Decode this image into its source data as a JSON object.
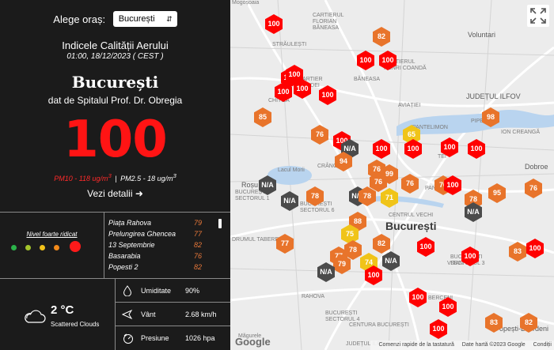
{
  "header": {
    "city_select_label": "Alege oraș:",
    "city_selected": "București",
    "title": "Indicele Calității Aerului",
    "datetime": "01:00, 18/12/2023 ( CEST )"
  },
  "current": {
    "city": "București",
    "source": "dat de Spitalul Prof. Dr. Obregia",
    "aqi": "100",
    "aqi_color": "#ff1414",
    "pm10": "PM10 - 118 ug/m",
    "pm10_sup": "3",
    "pm_separator": "|",
    "pm25": "PM2.5 - 18 ug/m",
    "pm25_sup": "3",
    "details_link": "Vezi detalii",
    "details_icon": "arrow-right-icon"
  },
  "level": {
    "label": "Nivel foarte ridicat",
    "scale_colors": [
      "#2bb34a",
      "#a3c42b",
      "#f2c21a",
      "#f28a1a",
      "#ff1a1a"
    ],
    "active_index": 4
  },
  "stations": [
    {
      "name": "Piața Rahova",
      "value": "79"
    },
    {
      "name": "Prelungirea Ghencea",
      "value": "77"
    },
    {
      "name": "13 Septembrie",
      "value": "82"
    },
    {
      "name": "Basarabia",
      "value": "76"
    },
    {
      "name": "Popesti 2",
      "value": "82"
    }
  ],
  "weather": {
    "icon": "cloud-icon",
    "temp": "2",
    "temp_unit": "°C",
    "condition": "Scattered Clouds",
    "rows": [
      {
        "icon": "droplet-icon",
        "label": "Umiditate",
        "value": "90%"
      },
      {
        "icon": "wind-icon",
        "label": "Vânt",
        "value": "2.68 km/h"
      },
      {
        "icon": "gauge-icon",
        "label": "Presiune",
        "value": "1026 hpa"
      }
    ]
  },
  "map": {
    "labels": [
      {
        "text": "Mogoșoaia",
        "cls": ""
      },
      {
        "text": "CARTIERUL\nFLORIAN\nBĂNEASA",
        "cls": ""
      },
      {
        "text": "Voluntari",
        "cls": "mid"
      },
      {
        "text": "STRĂULEȘTI",
        "cls": ""
      },
      {
        "text": "CARTIERUL\nHENRI COANDĂ",
        "cls": ""
      },
      {
        "text": "BĂNEASA",
        "cls": ""
      },
      {
        "text": "CARTIER\nBORDEI",
        "cls": ""
      },
      {
        "text": "JUDEȚUL ILFOV",
        "cls": "mid"
      },
      {
        "text": "CHITILA",
        "cls": ""
      },
      {
        "text": "AVIAȚIEI",
        "cls": ""
      },
      {
        "text": "PIPERA",
        "cls": ""
      },
      {
        "text": "PANTELIMON",
        "cls": ""
      },
      {
        "text": "Roșu",
        "cls": "mid"
      },
      {
        "text": "CRÂNGAȘI",
        "cls": ""
      },
      {
        "text": "Lacul Morii",
        "cls": ""
      },
      {
        "text": "TEI",
        "cls": ""
      },
      {
        "text": "ION CREANGĂ",
        "cls": ""
      },
      {
        "text": "Dobroe",
        "cls": "mid"
      },
      {
        "text": "BUCUREȘTI\nSECTORUL 6",
        "cls": ""
      },
      {
        "text": "CENTRUL VECHI",
        "cls": ""
      },
      {
        "text": "PANTELIMON",
        "cls": ""
      },
      {
        "text": "BUCUREȘTI\nSECTORUL 1",
        "cls": ""
      },
      {
        "text": "București",
        "cls": "big"
      },
      {
        "text": "BUCUREȘTI\nSECTORUL 3",
        "cls": ""
      },
      {
        "text": "DRUMUL TABEREI",
        "cls": ""
      },
      {
        "text": "VITAN",
        "cls": ""
      },
      {
        "text": "RAHOVA",
        "cls": ""
      },
      {
        "text": "BERCENI",
        "cls": ""
      },
      {
        "text": "Popești-Leordeni",
        "cls": "mid"
      },
      {
        "text": "BUCUREȘTI\nSECTORUL 4",
        "cls": ""
      },
      {
        "text": "Măgurele",
        "cls": ""
      },
      {
        "text": "CENTURA BUCUREȘTI",
        "cls": ""
      },
      {
        "text": "JUDEȚUL ILFOV",
        "cls": ""
      },
      {
        "text": "Condiții",
        "cls": ""
      }
    ],
    "markers": [
      {
        "v": "100",
        "c": "#ff0000"
      },
      {
        "v": "82",
        "c": "#e8742b"
      },
      {
        "v": "100",
        "c": "#ff0000"
      },
      {
        "v": "100",
        "c": "#ff0000"
      },
      {
        "v": "100",
        "c": "#ff0000"
      },
      {
        "v": "100",
        "c": "#ff0000"
      },
      {
        "v": "100",
        "c": "#ff0000"
      },
      {
        "v": "100",
        "c": "#ff0000"
      },
      {
        "v": "100",
        "c": "#ff0000"
      },
      {
        "v": "85",
        "c": "#e8742b"
      },
      {
        "v": "98",
        "c": "#e8742b"
      },
      {
        "v": "76",
        "c": "#e8742b"
      },
      {
        "v": "65",
        "c": "#f0c419"
      },
      {
        "v": "100",
        "c": "#ff0000"
      },
      {
        "v": "N/A",
        "c": "#4b4b4b"
      },
      {
        "v": "100",
        "c": "#ff0000"
      },
      {
        "v": "100",
        "c": "#ff0000"
      },
      {
        "v": "100",
        "c": "#ff0000"
      },
      {
        "v": "100",
        "c": "#ff0000"
      },
      {
        "v": "94",
        "c": "#e8742b"
      },
      {
        "v": "76",
        "c": "#e8742b"
      },
      {
        "v": "99",
        "c": "#e8742b"
      },
      {
        "v": "N/A",
        "c": "#4b4b4b"
      },
      {
        "v": "76",
        "c": "#e8742b"
      },
      {
        "v": "76",
        "c": "#e8742b"
      },
      {
        "v": "76",
        "c": "#e8742b"
      },
      {
        "v": "100",
        "c": "#ff0000"
      },
      {
        "v": "N/A",
        "c": "#4b4b4b"
      },
      {
        "v": "78",
        "c": "#e8742b"
      },
      {
        "v": "N/A",
        "c": "#4b4b4b"
      },
      {
        "v": "78",
        "c": "#e8742b"
      },
      {
        "v": "71",
        "c": "#f0c419"
      },
      {
        "v": "78",
        "c": "#e8742b"
      },
      {
        "v": "95",
        "c": "#e8742b"
      },
      {
        "v": "76",
        "c": "#e8742b"
      },
      {
        "v": "N/A",
        "c": "#4b4b4b"
      },
      {
        "v": "88",
        "c": "#e8742b"
      },
      {
        "v": "75",
        "c": "#f0c419"
      },
      {
        "v": "82",
        "c": "#e8742b"
      },
      {
        "v": "77",
        "c": "#e8742b"
      },
      {
        "v": "74",
        "c": "#f0c419"
      },
      {
        "v": "100",
        "c": "#ff0000"
      },
      {
        "v": "77",
        "c": "#e8742b"
      },
      {
        "v": "78",
        "c": "#e8742b"
      },
      {
        "v": "N/A",
        "c": "#4b4b4b"
      },
      {
        "v": "100",
        "c": "#ff0000"
      },
      {
        "v": "83",
        "c": "#e8742b"
      },
      {
        "v": "100",
        "c": "#ff0000"
      },
      {
        "v": "79",
        "c": "#e8742b"
      },
      {
        "v": "N/A",
        "c": "#4b4b4b"
      },
      {
        "v": "100",
        "c": "#ff0000"
      },
      {
        "v": "100",
        "c": "#ff0000"
      },
      {
        "v": "100",
        "c": "#ff0000"
      },
      {
        "v": "83",
        "c": "#e8742b"
      },
      {
        "v": "82",
        "c": "#e8742b"
      },
      {
        "v": "100",
        "c": "#ff0000"
      }
    ],
    "google_logo": "Google",
    "attribution": [
      "Comenzi rapide de la tastatură",
      "Date hartă ©2023 Google",
      "Condiții"
    ],
    "fullscreen_icon": "fullscreen-icon"
  }
}
